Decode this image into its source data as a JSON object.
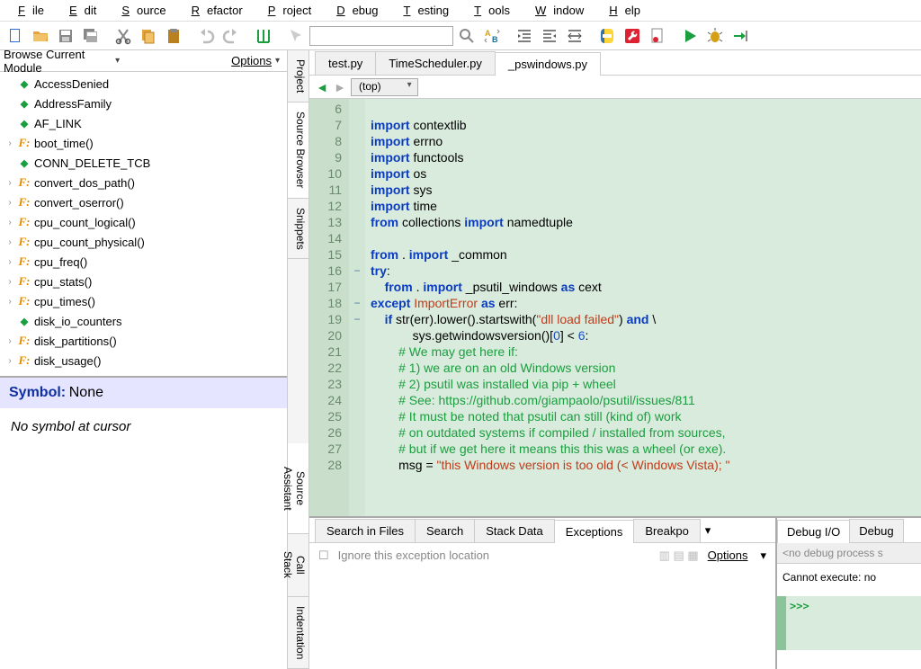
{
  "menu": [
    "File",
    "Edit",
    "Source",
    "Refactor",
    "Project",
    "Debug",
    "Testing",
    "Tools",
    "Window",
    "Help"
  ],
  "browser": {
    "title": "Browse Current Module",
    "options": "Options",
    "items": [
      {
        "icon": "diamond",
        "label": "AccessDenied",
        "exp": ""
      },
      {
        "icon": "diamond",
        "label": "AddressFamily",
        "exp": ""
      },
      {
        "icon": "diamond",
        "label": "AF_LINK",
        "exp": ""
      },
      {
        "icon": "f",
        "label": "boot_time()",
        "exp": "›"
      },
      {
        "icon": "diamond",
        "label": "CONN_DELETE_TCB",
        "exp": ""
      },
      {
        "icon": "f",
        "label": "convert_dos_path()",
        "exp": "›"
      },
      {
        "icon": "f",
        "label": "convert_oserror()",
        "exp": "›"
      },
      {
        "icon": "f",
        "label": "cpu_count_logical()",
        "exp": "›"
      },
      {
        "icon": "f",
        "label": "cpu_count_physical()",
        "exp": "›"
      },
      {
        "icon": "f",
        "label": "cpu_freq()",
        "exp": "›"
      },
      {
        "icon": "f",
        "label": "cpu_stats()",
        "exp": "›"
      },
      {
        "icon": "f",
        "label": "cpu_times()",
        "exp": "›"
      },
      {
        "icon": "diamond",
        "label": "disk_io_counters",
        "exp": ""
      },
      {
        "icon": "f",
        "label": "disk_partitions()",
        "exp": "›"
      },
      {
        "icon": "f",
        "label": "disk_usage()",
        "exp": "›"
      }
    ]
  },
  "symbol": {
    "key": "Symbol:",
    "value": "None",
    "msg": "No symbol at cursor"
  },
  "sidetabs_top": [
    "Project",
    "Source Browser",
    "Snippets"
  ],
  "sidetabs_bottom": [
    "Source Assistant",
    "Call Stack",
    "Indentation"
  ],
  "editor_tabs": [
    "test.py",
    "TimeScheduler.py",
    "_pswindows.py"
  ],
  "active_editor_tab": 2,
  "scope": "(top)",
  "line_start": 6,
  "code_lines": [
    {
      "n": 6,
      "fold": "",
      "tokens": []
    },
    {
      "n": 7,
      "fold": "",
      "tokens": [
        [
          "kw",
          "import"
        ],
        [
          "nm",
          " contextlib"
        ]
      ]
    },
    {
      "n": 8,
      "fold": "",
      "tokens": [
        [
          "kw",
          "import"
        ],
        [
          "nm",
          " errno"
        ]
      ]
    },
    {
      "n": 9,
      "fold": "",
      "tokens": [
        [
          "kw",
          "import"
        ],
        [
          "nm",
          " functools"
        ]
      ]
    },
    {
      "n": 10,
      "fold": "",
      "tokens": [
        [
          "kw",
          "import"
        ],
        [
          "nm",
          " os"
        ]
      ]
    },
    {
      "n": 11,
      "fold": "",
      "tokens": [
        [
          "kw",
          "import"
        ],
        [
          "nm",
          " sys"
        ]
      ]
    },
    {
      "n": 12,
      "fold": "",
      "tokens": [
        [
          "kw",
          "import"
        ],
        [
          "nm",
          " time"
        ]
      ]
    },
    {
      "n": 13,
      "fold": "",
      "tokens": [
        [
          "kw",
          "from"
        ],
        [
          "nm",
          " collections "
        ],
        [
          "kw",
          "import"
        ],
        [
          "nm",
          " namedtuple"
        ]
      ]
    },
    {
      "n": 14,
      "fold": "",
      "tokens": []
    },
    {
      "n": 15,
      "fold": "",
      "tokens": [
        [
          "kw",
          "from"
        ],
        [
          "nm",
          " . "
        ],
        [
          "kw",
          "import"
        ],
        [
          "nm",
          " _common"
        ]
      ]
    },
    {
      "n": 16,
      "fold": "−",
      "tokens": [
        [
          "kw",
          "try"
        ],
        [
          "op",
          ":"
        ]
      ]
    },
    {
      "n": 17,
      "fold": "",
      "tokens": [
        [
          "nm",
          "    "
        ],
        [
          "kw",
          "from"
        ],
        [
          "nm",
          " . "
        ],
        [
          "kw",
          "import"
        ],
        [
          "nm",
          " _psutil_windows "
        ],
        [
          "kw",
          "as"
        ],
        [
          "nm",
          " cext"
        ]
      ]
    },
    {
      "n": 18,
      "fold": "−",
      "tokens": [
        [
          "kw",
          "except"
        ],
        [
          "nm",
          " "
        ],
        [
          "err",
          "ImportError"
        ],
        [
          "nm",
          " "
        ],
        [
          "kw",
          "as"
        ],
        [
          "nm",
          " err:"
        ]
      ]
    },
    {
      "n": 19,
      "fold": "−",
      "tokens": [
        [
          "nm",
          "    "
        ],
        [
          "kw",
          "if"
        ],
        [
          "nm",
          " str(err).lower().startswith("
        ],
        [
          "str",
          "\"dll load failed\""
        ],
        [
          "nm",
          ") "
        ],
        [
          "kw",
          "and"
        ],
        [
          "nm",
          " \\"
        ]
      ]
    },
    {
      "n": 20,
      "fold": "",
      "tokens": [
        [
          "nm",
          "            sys.getwindowsversion()["
        ],
        [
          "num",
          "0"
        ],
        [
          "nm",
          "] "
        ],
        [
          "op",
          "<"
        ],
        [
          "nm",
          " "
        ],
        [
          "num",
          "6"
        ],
        [
          "nm",
          ":"
        ]
      ]
    },
    {
      "n": 21,
      "fold": "",
      "tokens": [
        [
          "nm",
          "        "
        ],
        [
          "cm",
          "# We may get here if:"
        ]
      ]
    },
    {
      "n": 22,
      "fold": "",
      "tokens": [
        [
          "nm",
          "        "
        ],
        [
          "cm",
          "# 1) we are on an old Windows version"
        ]
      ]
    },
    {
      "n": 23,
      "fold": "",
      "tokens": [
        [
          "nm",
          "        "
        ],
        [
          "cm",
          "# 2) psutil was installed via pip + wheel"
        ]
      ]
    },
    {
      "n": 24,
      "fold": "",
      "tokens": [
        [
          "nm",
          "        "
        ],
        [
          "cm",
          "# See: https://github.com/giampaolo/psutil/issues/811"
        ]
      ]
    },
    {
      "n": 25,
      "fold": "",
      "tokens": [
        [
          "nm",
          "        "
        ],
        [
          "cm",
          "# It must be noted that psutil can still (kind of) work"
        ]
      ]
    },
    {
      "n": 26,
      "fold": "",
      "tokens": [
        [
          "nm",
          "        "
        ],
        [
          "cm",
          "# on outdated systems if compiled / installed from sources,"
        ]
      ]
    },
    {
      "n": 27,
      "fold": "",
      "tokens": [
        [
          "nm",
          "        "
        ],
        [
          "cm",
          "# but if we get here it means this this was a wheel (or exe)."
        ]
      ]
    },
    {
      "n": 28,
      "fold": "",
      "tokens": [
        [
          "nm",
          "        msg = "
        ],
        [
          "str",
          "\"this Windows version is too old (< Windows Vista); \""
        ]
      ]
    }
  ],
  "bottom_tabs": [
    "Search in Files",
    "Search",
    "Stack Data",
    "Exceptions",
    "Breakpo"
  ],
  "active_bottom_tab": 3,
  "bottom_checkbox": "Ignore this exception location",
  "bottom_options": "Options",
  "dbg_tabs": [
    "Debug I/O",
    "Debug"
  ],
  "active_dbg_tab": 0,
  "dbg_grey": "<no debug process s",
  "dbg_msg": "Cannot execute: no",
  "dbg_prompt": ">>>"
}
